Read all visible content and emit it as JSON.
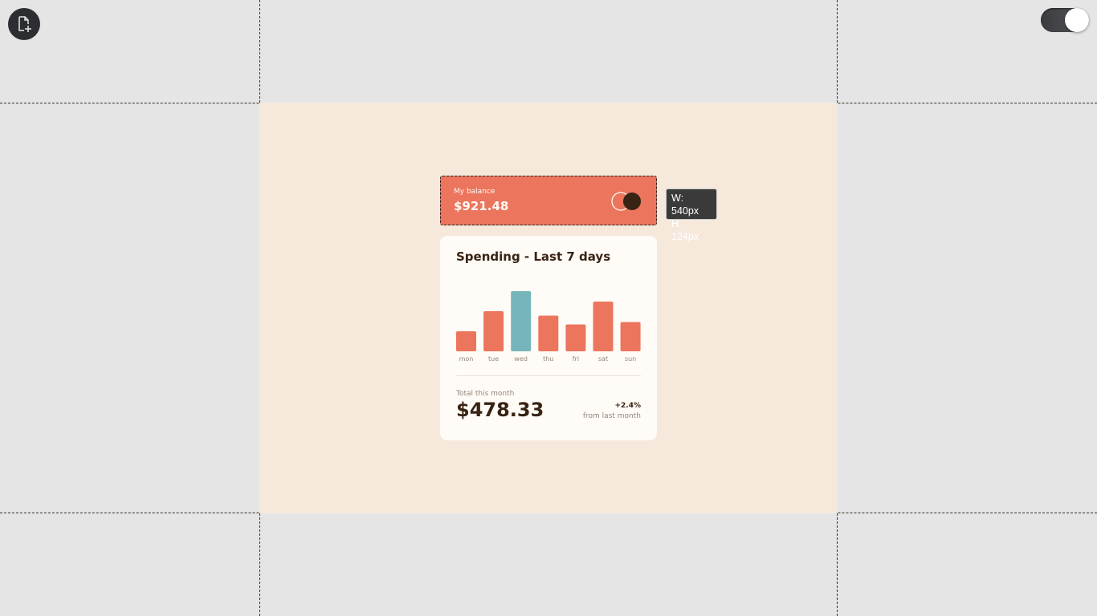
{
  "toolbar": {
    "new_file_icon": "file-plus-icon",
    "toggle_state": "on"
  },
  "balance": {
    "label": "My balance",
    "amount": "$921.48",
    "logo_icon": "overlapping-circles-logo"
  },
  "dimension_tooltip": {
    "width": "W: 540px",
    "height": "H: 124px"
  },
  "spending": {
    "title": "Spending - Last 7 days",
    "total_label": "Total this month",
    "total_amount": "$478.33",
    "change": "+2.4%",
    "change_label": "from last month"
  },
  "colors": {
    "bar": "#ec755d",
    "bar_highlight": "#76b5bc",
    "balance_bg": "#ec755d",
    "page_bg": "#f6e9dc",
    "card_bg": "#fffbf6",
    "text_dark": "#382314",
    "text_muted": "#93867b"
  },
  "chart_data": {
    "type": "bar",
    "categories": [
      "mon",
      "tue",
      "wed",
      "thu",
      "fri",
      "sat",
      "sun"
    ],
    "values": [
      17.45,
      34.91,
      52.36,
      31.07,
      23.39,
      43.28,
      25.48
    ],
    "highlight_index": 2,
    "ylim": [
      0,
      52.36
    ]
  }
}
